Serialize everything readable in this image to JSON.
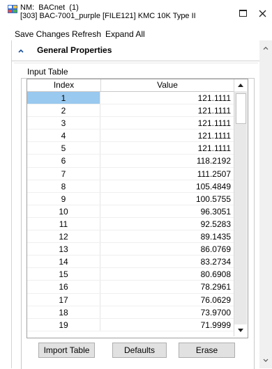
{
  "window": {
    "title_line1": "NM:  BACnet  (1)",
    "title_line2": "[303] BAC-7001_purple [FILE121] KMC 10K Type II",
    "icons": [
      "app-icon",
      "maximize-icon",
      "close-icon"
    ]
  },
  "menu": {
    "save_changes": "Save Changes",
    "refresh": "Refresh",
    "expand_all": "Expand All"
  },
  "section": {
    "title": "General Properties",
    "expanded": true
  },
  "input_table": {
    "label": "Input Table",
    "columns": [
      "Index",
      "Value"
    ],
    "selected_index": 0,
    "rows": [
      {
        "index": "1",
        "value": "121.1111"
      },
      {
        "index": "2",
        "value": "121.1111"
      },
      {
        "index": "3",
        "value": "121.1111"
      },
      {
        "index": "4",
        "value": "121.1111"
      },
      {
        "index": "5",
        "value": "121.1111"
      },
      {
        "index": "6",
        "value": "118.2192"
      },
      {
        "index": "7",
        "value": "111.2507"
      },
      {
        "index": "8",
        "value": "105.4849"
      },
      {
        "index": "9",
        "value": "100.5755"
      },
      {
        "index": "10",
        "value": "96.3051"
      },
      {
        "index": "11",
        "value": "92.5283"
      },
      {
        "index": "12",
        "value": "89.1435"
      },
      {
        "index": "13",
        "value": "86.0769"
      },
      {
        "index": "14",
        "value": "83.2734"
      },
      {
        "index": "15",
        "value": "80.6908"
      },
      {
        "index": "16",
        "value": "78.2961"
      },
      {
        "index": "17",
        "value": "76.0629"
      },
      {
        "index": "18",
        "value": "73.9700"
      },
      {
        "index": "19",
        "value": "71.9999"
      }
    ]
  },
  "buttons": {
    "import_table": "Import Table",
    "defaults": "Defaults",
    "erase": "Erase"
  },
  "colors": {
    "selection": "#99c9ef",
    "button_face": "#e1e1e1",
    "scrollbar_track": "#e8e8e8"
  }
}
